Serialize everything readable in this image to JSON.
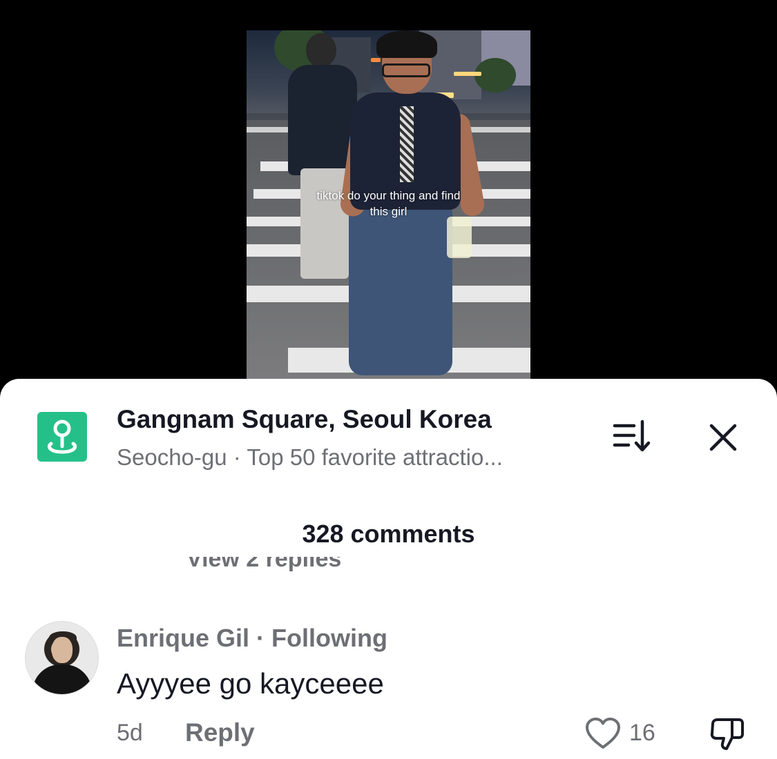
{
  "video": {
    "caption_line1": "tiktok do your thing and find",
    "caption_line2": "this girl"
  },
  "location": {
    "icon": "location-pin-icon",
    "title": "Gangnam Square, Seoul Korea",
    "subtitle": "Seocho-gu · Top 50 favorite attractio..."
  },
  "header": {
    "sort_icon": "sort-icon",
    "close_icon": "close-icon",
    "comments_count": "328 comments"
  },
  "collapsed_replies": {
    "label": "View 2 replies"
  },
  "comment": {
    "author": "Enrique Gil · Following",
    "text": "Ayyyee go kayceeee",
    "age": "5d",
    "reply_label": "Reply",
    "like_count": "16"
  },
  "colors": {
    "accent": "#25c08a",
    "text_primary": "#161823",
    "text_secondary": "#6e6f75"
  }
}
